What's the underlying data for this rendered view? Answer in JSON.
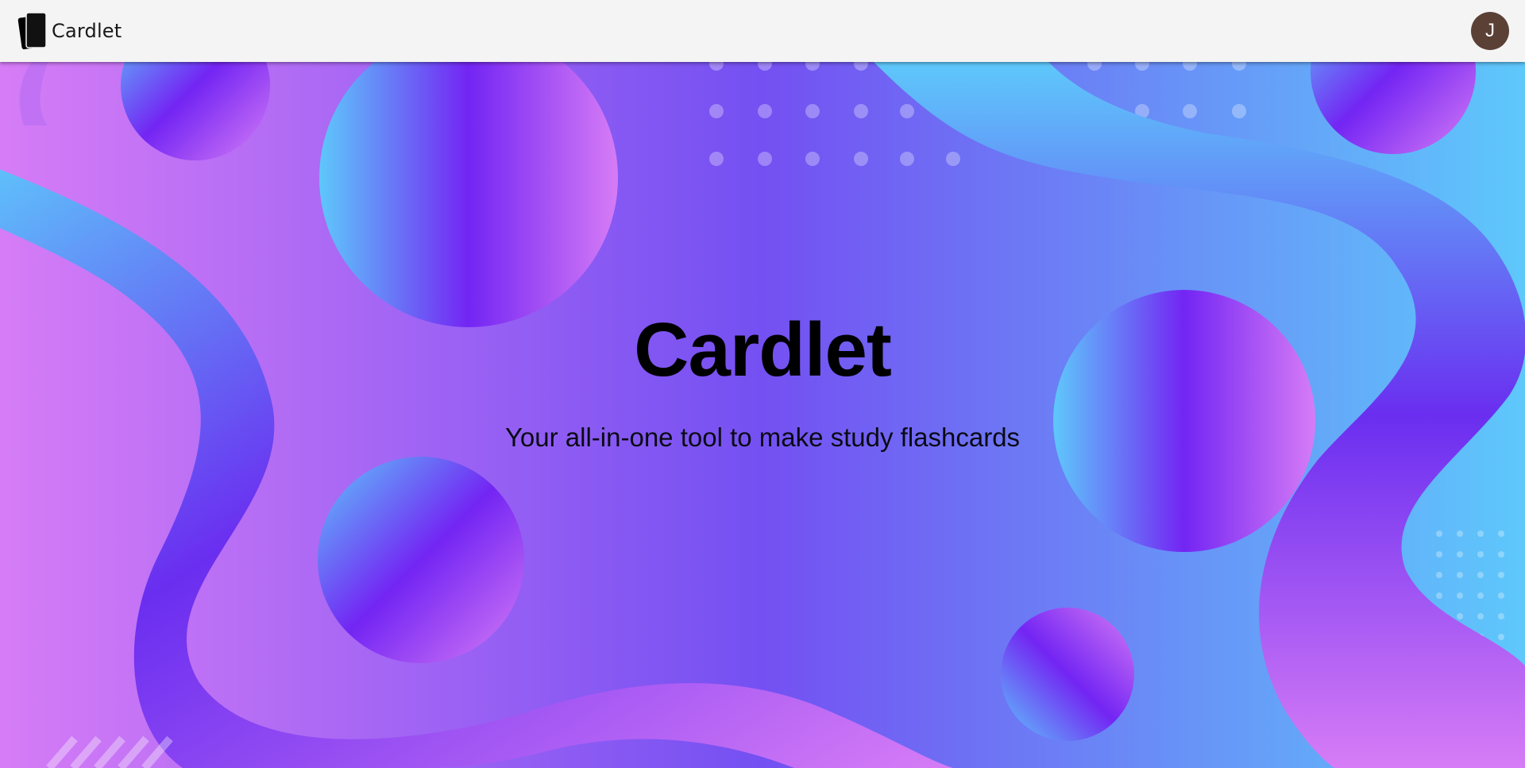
{
  "header": {
    "brand_name": "Cardlet",
    "brand_icon": "cards-icon",
    "avatar_initial": "J",
    "avatar_color": "#5b4036",
    "background": "#f4f4f4"
  },
  "hero": {
    "title": "Cardlet",
    "subtitle": "Your all-in-one tool to make study flashcards",
    "gradient_colors": [
      "#d67cf6",
      "#7450f2",
      "#5ec8fb"
    ]
  }
}
